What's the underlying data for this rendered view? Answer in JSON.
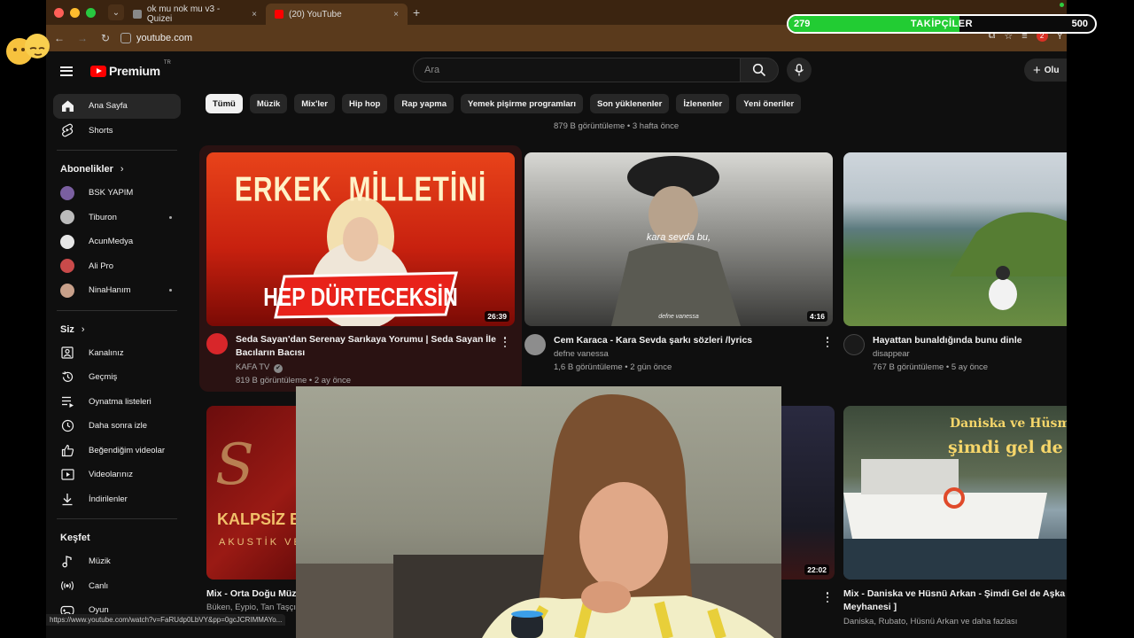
{
  "browser": {
    "tabs": [
      {
        "title": "ok mu nok mu v3 - Quizei",
        "close": "×"
      },
      {
        "title": "(20) YouTube",
        "close": "×"
      }
    ],
    "new_tab": "+",
    "url": "youtube.com",
    "notification_count": "2",
    "profile_initial": "Y",
    "status_url": "https://www.youtube.com/watch?v=FaRUdp0LbVY&pp=0gcJCRIMMAYo..."
  },
  "header": {
    "logo_text": "Premium",
    "logo_sup": "TR",
    "search_placeholder": "Ara",
    "create_label": "Olu"
  },
  "sidebar": {
    "main": [
      {
        "label": "Ana Sayfa",
        "icon": "home-icon"
      },
      {
        "label": "Shorts",
        "icon": "shorts-icon"
      }
    ],
    "subs_heading": "Abonelikler",
    "subscriptions": [
      {
        "label": "BSK YAPIM",
        "color": "#7a5fa0",
        "dot": false
      },
      {
        "label": "Tiburon",
        "color": "#bbbbbb",
        "dot": true
      },
      {
        "label": "AcunMedya",
        "color": "#e6e6e6",
        "dot": false
      },
      {
        "label": "Ali Pro",
        "color": "#c94a4a",
        "dot": false
      },
      {
        "label": "NinaHanım",
        "color": "#c8a08a",
        "dot": true
      }
    ],
    "you_heading": "Siz",
    "you_items": [
      {
        "label": "Kanalınız",
        "icon": "channel-icon"
      },
      {
        "label": "Geçmiş",
        "icon": "history-icon"
      },
      {
        "label": "Oynatma listeleri",
        "icon": "playlist-icon"
      },
      {
        "label": "Daha sonra izle",
        "icon": "clock-icon"
      },
      {
        "label": "Beğendiğim videolar",
        "icon": "thumbs-up-icon"
      },
      {
        "label": "Videolarınız",
        "icon": "your-videos-icon"
      },
      {
        "label": "İndirilenler",
        "icon": "download-icon"
      }
    ],
    "explore_heading": "Keşfet",
    "explore_items": [
      {
        "label": "Müzik",
        "icon": "music-icon"
      },
      {
        "label": "Canlı",
        "icon": "live-icon"
      },
      {
        "label": "Oyun",
        "icon": "gaming-icon"
      }
    ]
  },
  "chips": [
    "Tümü",
    "Müzik",
    "Mix'ler",
    "Hip hop",
    "Rap yapma",
    "Yemek pişirme programları",
    "Son yüklenenler",
    "İzlenenler",
    "Yeni öneriler"
  ],
  "top_meta": "879 B görüntüleme • 3 hafta önce",
  "videos": [
    {
      "title_line1": "Seda Sayan'dan Serenay Sarıkaya Yorumu | Seda Sayan İle",
      "title_line2": "Bacıların Bacısı",
      "channel": "KAFA TV",
      "verified": "✔",
      "meta": "819 B görüntüleme • 2 ay önce",
      "duration": "26:39",
      "thumb_text_top": "ERKEK  MİLLETİNİ",
      "thumb_text_bottom": "HEP DÜRTECEKSİN"
    },
    {
      "title_line1": "Cem Karaca - Kara Sevda şarkı sözleri /lyrics",
      "channel": "defne vanessa",
      "meta": "1,6 B görüntüleme • 2 gün önce",
      "duration": "4:16",
      "thumb_caption": "kara sevda bu,",
      "thumb_watermark": "defne vanessa"
    },
    {
      "title_line1": "Hayattan bunaldığında bunu dinle",
      "channel": "disappear",
      "meta": "767 B görüntüleme • 5 ay önce"
    },
    {
      "title_line1": "Mix - Orta Doğu Müz",
      "channel": "Büken, Eypio, Tan Taşçı",
      "thumb_text": "KALPSİZ BİR Ş",
      "thumb_sub": "AKUSTİK VE"
    },
    {
      "duration": "22:02"
    },
    {
      "title_line1": "Mix - Daniska ve Hüsnü Arkan - Şimdi Gel de Aşka İ",
      "title_line2": "Meyhanesi ]",
      "channel": "Daniska, Rubato, Hüsnü Arkan ve daha fazlası",
      "thumb_line1": "Daniska ve Hüsmi Ark",
      "thumb_line2": "şimdi gel de aşk"
    }
  ],
  "follow": {
    "current": 279,
    "label": "TAKİPÇİLER",
    "goal": 500
  }
}
